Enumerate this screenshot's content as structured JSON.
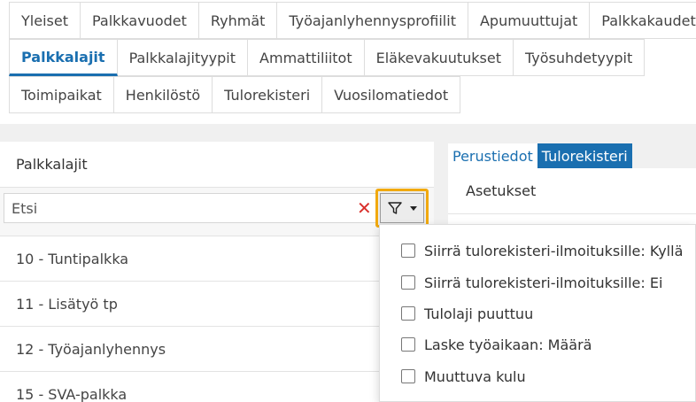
{
  "tabs": {
    "row1": [
      "Yleiset",
      "Palkkavuodet",
      "Ryhmät",
      "Työajanlyhennysprofiilit",
      "Apumuuttujat",
      "Palkkakaudet"
    ],
    "row2": [
      "Palkkalajit",
      "Palkkalajityypit",
      "Ammattiliitot",
      "Eläkevakuutukset",
      "Työsuhdetyypit"
    ],
    "row3": [
      "Toimipaikat",
      "Henkilöstö",
      "Tulorekisteri",
      "Vuosilomatiedot"
    ],
    "active": "Palkkalajit"
  },
  "left_panel": {
    "title": "Palkkalajit",
    "search_placeholder": "Etsi",
    "search_value": "",
    "items": [
      "10 - Tuntipalkka",
      "11 - Lisätyö tp",
      "12 - Työajanlyhennys",
      "15 - SVA-palkka"
    ]
  },
  "right_panel": {
    "tabs": [
      "Perustiedot",
      "Tulorekisteri"
    ],
    "active_tab": "Tulorekisteri",
    "section_title": "Asetukset"
  },
  "filter_menu": {
    "options": [
      "Siirrä tulorekisteri-ilmoituksille: Kyllä",
      "Siirrä tulorekisteri-ilmoituksille: Ei",
      "Tulolaji puuttuu",
      "Laske työaikaan: Määrä",
      "Muuttuva kulu"
    ]
  },
  "colors": {
    "accent": "#1a6fb0",
    "highlight_border": "#f1a90f",
    "clear_icon": "#d9302c"
  },
  "icons": {
    "clear": "close-icon",
    "filter": "filter-icon",
    "caret": "chevron-down-icon"
  }
}
